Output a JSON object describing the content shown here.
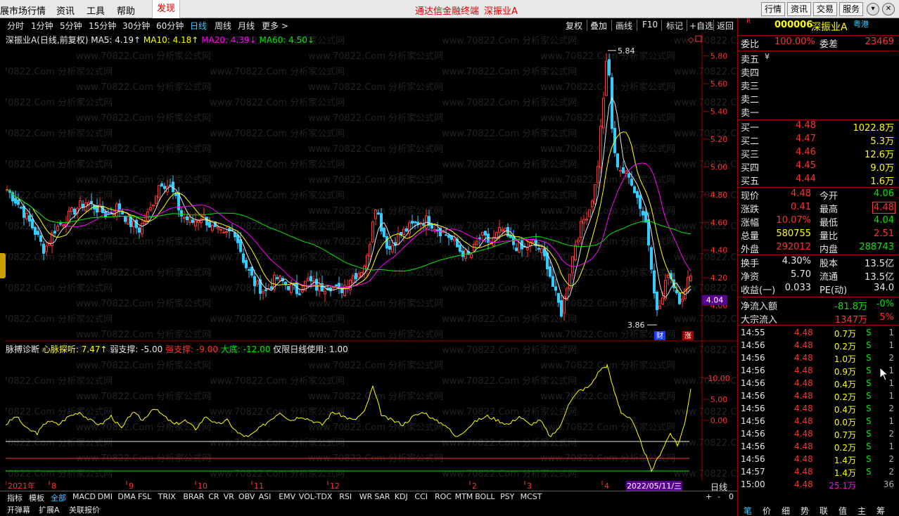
{
  "menubar": {
    "items": [
      "展市场行情",
      "资讯",
      "工具",
      "帮助"
    ],
    "discover": "发现",
    "center_title": "通达信金融终端",
    "center_stock": "深振业A",
    "toolbuttons": [
      "行情",
      "资讯",
      "交易",
      "服务"
    ]
  },
  "periods": {
    "tabs": [
      "分时",
      "1分钟",
      "5分钟",
      "15分钟",
      "30分钟",
      "60分钟",
      "日线",
      "周线",
      "月线",
      "更多 >"
    ],
    "active": "日线",
    "buttons": [
      "复权",
      "叠加",
      "画线",
      "F10",
      "标记",
      "+自选",
      "返回"
    ]
  },
  "chart_info": {
    "name": "深振业A",
    "mode": "(日线,前复权)",
    "ma5": "MA5: 4.19↑",
    "ma10": "MA10: 4.18↑",
    "ma20": "MA20: 4.39↓",
    "ma60": "MA60: 4.50↓",
    "ma5_color": "#e6e6e6",
    "ma10_color": "#ffff00",
    "ma20_color": "#ff00ff",
    "ma60_color": "#00e600",
    "up_color": "#ff3232",
    "down_color": "#33ccff"
  },
  "indicator_info": {
    "name": "脉搏诊断",
    "xmt": "心脉探听: 7.47↑",
    "weak": "弱支撑: -5.00",
    "strong": "强支撑: -9.00",
    "bottom": "大底: -12.00",
    "note": "仅限日线使用: 1.00"
  },
  "chart_data": [
    {
      "type": "candlestick",
      "title": "深振业A (日线,前复权)",
      "y_ticks": [
        "5.80",
        "5.60",
        "5.40",
        "5.20",
        "5.00",
        "4.80",
        "4.60",
        "4.40",
        "4.20",
        "4.00"
      ],
      "ylim": [
        3.8,
        5.9
      ],
      "x_ticks": [
        "2021年",
        "8",
        "9",
        "10",
        "11",
        "12",
        "2",
        "3",
        "4"
      ],
      "annotations": {
        "high": "5.84",
        "low": "3.86",
        "cursor_date": "2022/05/11/三",
        "current_price_tag": "4.04",
        "badge_cai": "财",
        "badge_zhang": "涨"
      },
      "series": [
        {
          "name": "MA5"
        },
        {
          "name": "MA10"
        },
        {
          "name": "MA20"
        },
        {
          "name": "MA60"
        }
      ],
      "anchors": [
        [
          0,
          4.85
        ],
        [
          20,
          4.72
        ],
        [
          40,
          4.55
        ],
        [
          55,
          4.4
        ],
        [
          70,
          4.55
        ],
        [
          85,
          4.62
        ],
        [
          100,
          4.7
        ],
        [
          115,
          4.75
        ],
        [
          130,
          4.7
        ],
        [
          145,
          4.65
        ],
        [
          160,
          4.72
        ],
        [
          175,
          4.6
        ],
        [
          190,
          4.55
        ],
        [
          205,
          4.68
        ],
        [
          220,
          4.9
        ],
        [
          235,
          4.85
        ],
        [
          250,
          4.65
        ],
        [
          265,
          4.6
        ],
        [
          280,
          4.65
        ],
        [
          295,
          4.55
        ],
        [
          310,
          4.5
        ],
        [
          325,
          4.55
        ],
        [
          340,
          4.3
        ],
        [
          355,
          4.15
        ],
        [
          370,
          4.1
        ],
        [
          385,
          4.2
        ],
        [
          400,
          4.15
        ],
        [
          415,
          4.1
        ],
        [
          430,
          4.18
        ],
        [
          445,
          4.12
        ],
        [
          460,
          4.15
        ],
        [
          475,
          4.1
        ],
        [
          490,
          4.2
        ],
        [
          505,
          4.25
        ],
        [
          515,
          4.35
        ],
        [
          525,
          4.75
        ],
        [
          535,
          4.55
        ],
        [
          545,
          4.4
        ],
        [
          555,
          4.48
        ],
        [
          570,
          4.55
        ],
        [
          585,
          4.6
        ],
        [
          600,
          4.62
        ],
        [
          615,
          4.55
        ],
        [
          630,
          4.5
        ],
        [
          645,
          4.4
        ],
        [
          660,
          4.35
        ],
        [
          675,
          4.5
        ],
        [
          690,
          4.45
        ],
        [
          705,
          4.55
        ],
        [
          720,
          4.45
        ],
        [
          735,
          4.4
        ],
        [
          750,
          4.45
        ],
        [
          760,
          4.4
        ],
        [
          770,
          4.3
        ],
        [
          780,
          4.1
        ],
        [
          790,
          3.95
        ],
        [
          800,
          4.2
        ],
        [
          810,
          4.45
        ],
        [
          820,
          4.6
        ],
        [
          830,
          4.7
        ],
        [
          840,
          4.9
        ],
        [
          848,
          5.4
        ],
        [
          856,
          5.84
        ],
        [
          864,
          5.1
        ],
        [
          872,
          5.0
        ],
        [
          880,
          4.95
        ],
        [
          890,
          4.9
        ],
        [
          900,
          4.75
        ],
        [
          910,
          4.6
        ],
        [
          918,
          4.3
        ],
        [
          926,
          3.95
        ],
        [
          934,
          4.05
        ],
        [
          942,
          4.25
        ],
        [
          950,
          4.15
        ],
        [
          958,
          4.05
        ],
        [
          966,
          4.1
        ],
        [
          974,
          4.25
        ]
      ],
      "ind_ylim": [
        -14,
        15
      ],
      "ind_ticks": [
        "10.00",
        "5.00",
        "0.00"
      ],
      "ind_levels": {
        "weak": -5,
        "strong": -9,
        "bottom": -12
      },
      "ind_values": [
        [
          0,
          -1
        ],
        [
          15,
          1
        ],
        [
          30,
          -2
        ],
        [
          45,
          -3
        ],
        [
          60,
          0
        ],
        [
          75,
          -1
        ],
        [
          90,
          1
        ],
        [
          105,
          2
        ],
        [
          120,
          0
        ],
        [
          135,
          -1
        ],
        [
          150,
          1
        ],
        [
          165,
          -2
        ],
        [
          180,
          2
        ],
        [
          195,
          0
        ],
        [
          210,
          3
        ],
        [
          225,
          1
        ],
        [
          240,
          -1
        ],
        [
          255,
          0
        ],
        [
          270,
          -2
        ],
        [
          285,
          1
        ],
        [
          300,
          -1
        ],
        [
          315,
          0
        ],
        [
          330,
          -3
        ],
        [
          345,
          -4
        ],
        [
          360,
          -2
        ],
        [
          375,
          0
        ],
        [
          390,
          2
        ],
        [
          405,
          0
        ],
        [
          420,
          1
        ],
        [
          435,
          0
        ],
        [
          450,
          -1
        ],
        [
          465,
          2
        ],
        [
          480,
          1
        ],
        [
          495,
          0
        ],
        [
          510,
          2
        ],
        [
          522,
          8
        ],
        [
          535,
          1
        ],
        [
          550,
          0
        ],
        [
          565,
          -1
        ],
        [
          580,
          1
        ],
        [
          595,
          2
        ],
        [
          610,
          0
        ],
        [
          625,
          -1
        ],
        [
          640,
          -4
        ],
        [
          655,
          -2
        ],
        [
          670,
          0
        ],
        [
          685,
          1
        ],
        [
          700,
          0
        ],
        [
          715,
          -1
        ],
        [
          730,
          1
        ],
        [
          745,
          -1
        ],
        [
          760,
          0
        ],
        [
          775,
          -4
        ],
        [
          790,
          -1
        ],
        [
          800,
          4
        ],
        [
          815,
          7
        ],
        [
          830,
          8
        ],
        [
          845,
          12
        ],
        [
          855,
          13
        ],
        [
          865,
          7
        ],
        [
          875,
          2
        ],
        [
          890,
          0
        ],
        [
          905,
          -6
        ],
        [
          918,
          -12
        ],
        [
          930,
          -8
        ],
        [
          945,
          -3
        ],
        [
          955,
          -6
        ],
        [
          965,
          -1
        ],
        [
          974,
          7.5
        ]
      ]
    }
  ],
  "bottom_tabs": {
    "row1": [
      "指标",
      "模板",
      "全部",
      "MACD",
      "DMI",
      "DMA",
      "FSL",
      "TRIX",
      "BRAR",
      "CR",
      "VR",
      "OBV",
      "ASI",
      "EMV",
      "VOL-TDX",
      "RSI",
      "WR",
      "SAR",
      "KDJ",
      "CCI",
      "ROC",
      "MTM",
      "BOLL",
      "PSY",
      "MCST"
    ],
    "active": "全部",
    "row2": [
      "开弹幕",
      "扩展A",
      "关联报价"
    ],
    "period_label": "日线",
    "controls": [
      "+",
      "-",
      "0"
    ]
  },
  "quote": {
    "r_mark": "R",
    "code": "000006",
    "name": "深振业A",
    "tag": "粤港",
    "weibi_label": "委比",
    "weibi": "100.00%",
    "weicha_label": "委差",
    "weicha": "23469",
    "asks": [
      {
        "label": "卖五",
        "extra": "¥"
      },
      {
        "label": "卖四"
      },
      {
        "label": "卖三"
      },
      {
        "label": "卖二"
      },
      {
        "label": "卖一"
      }
    ],
    "bids": [
      {
        "label": "买一",
        "price": "4.48",
        "vol": "1022.8万"
      },
      {
        "label": "买二",
        "price": "4.47",
        "vol": "5.3万"
      },
      {
        "label": "买三",
        "price": "4.46",
        "vol": "12.6万"
      },
      {
        "label": "买四",
        "price": "4.45",
        "vol": "9.0万"
      },
      {
        "label": "买五",
        "price": "4.44",
        "vol": "1.6万"
      }
    ],
    "stats": [
      {
        "l1": "现价",
        "v1": "4.48",
        "c1": "red",
        "l2": "今开",
        "v2": "4.06",
        "c2": "green"
      },
      {
        "l1": "涨跌",
        "v1": "0.41",
        "c1": "red",
        "l2": "最高",
        "v2": "4.48",
        "c2": "redbox"
      },
      {
        "l1": "涨幅",
        "v1": "10.07%",
        "c1": "red",
        "l2": "最低",
        "v2": "4.04",
        "c2": "green"
      },
      {
        "l1": "总量",
        "v1": "580755",
        "c1": "yellow",
        "l2": "量比",
        "v2": "2.51",
        "c2": "red"
      },
      {
        "l1": "外盘",
        "v1": "292012",
        "c1": "red",
        "l2": "内盘",
        "v2": "288743",
        "c2": "green"
      }
    ],
    "stats2": [
      {
        "l1": "换手",
        "v1": "4.30%",
        "l2": "股本",
        "v2": "13.5亿"
      },
      {
        "l1": "净资",
        "v1": "5.70",
        "l2": "流通",
        "v2": "13.5亿"
      },
      {
        "l1": "收益(一)",
        "v1": "0.033",
        "l2": "PE(动)",
        "v2": "34.0"
      }
    ],
    "flow": [
      {
        "label": "净流入额",
        "v1": "-81.8万",
        "v2": "-0%",
        "c": "green"
      },
      {
        "label": "大宗流入",
        "v1": "1347万",
        "v2": "5%",
        "c": "red"
      }
    ],
    "ticks": [
      {
        "t": "14:55",
        "p": "4.48",
        "v": "0.7万",
        "s": "S",
        "n": "1"
      },
      {
        "t": "14:56",
        "p": "4.48",
        "v": "0.2万",
        "s": "S",
        "n": "1"
      },
      {
        "t": "14:56",
        "p": "4.48",
        "v": "1.0万",
        "s": "S",
        "n": "2"
      },
      {
        "t": "14:56",
        "p": "4.48",
        "v": "0.9万",
        "s": "S",
        "n": "1"
      },
      {
        "t": "14:56",
        "p": "4.48",
        "v": "0.4万",
        "s": "S",
        "n": "1"
      },
      {
        "t": "14:56",
        "p": "4.48",
        "v": "0.2万",
        "s": "S",
        "n": "1"
      },
      {
        "t": "14:56",
        "p": "4.48",
        "v": "0.4万",
        "s": "S",
        "n": "2"
      },
      {
        "t": "14:56",
        "p": "4.48",
        "v": "0.0万",
        "s": "S",
        "n": "1"
      },
      {
        "t": "14:56",
        "p": "4.48",
        "v": "0.7万",
        "s": "S",
        "n": "2"
      },
      {
        "t": "14:56",
        "p": "4.48",
        "v": "0.2万",
        "s": "S",
        "n": "1"
      },
      {
        "t": "14:56",
        "p": "4.48",
        "v": "1.4万",
        "s": "S",
        "n": "2"
      },
      {
        "t": "14:57",
        "p": "4.48",
        "v": "1.4万",
        "s": "S",
        "n": "2"
      },
      {
        "t": "15:00",
        "p": "4.48",
        "v": "25.1万",
        "s": "",
        "n": "36"
      }
    ],
    "footer_tabs": [
      "笔",
      "价",
      "细",
      "势",
      "联",
      "值",
      "主",
      "筹"
    ]
  },
  "watermark": "www.70822.Com 分析家公式网"
}
